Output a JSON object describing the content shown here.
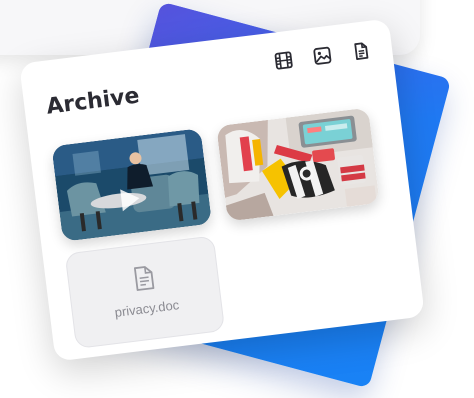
{
  "archive": {
    "title": "Archive",
    "toolbar": [
      {
        "name": "video-filter",
        "icon": "film-icon"
      },
      {
        "name": "image-filter",
        "icon": "image-icon"
      },
      {
        "name": "document-filter",
        "icon": "file-text-icon"
      }
    ],
    "items": [
      {
        "type": "video",
        "icon": "play-icon"
      },
      {
        "type": "image"
      },
      {
        "type": "document",
        "icon": "file-text-icon",
        "filename": "privacy.doc"
      }
    ]
  },
  "colors": {
    "accent_blue": "#1f7bf2",
    "title": "#2b2b33",
    "file_tile_bg": "#f0f0f2",
    "file_text": "#8b8b92"
  }
}
